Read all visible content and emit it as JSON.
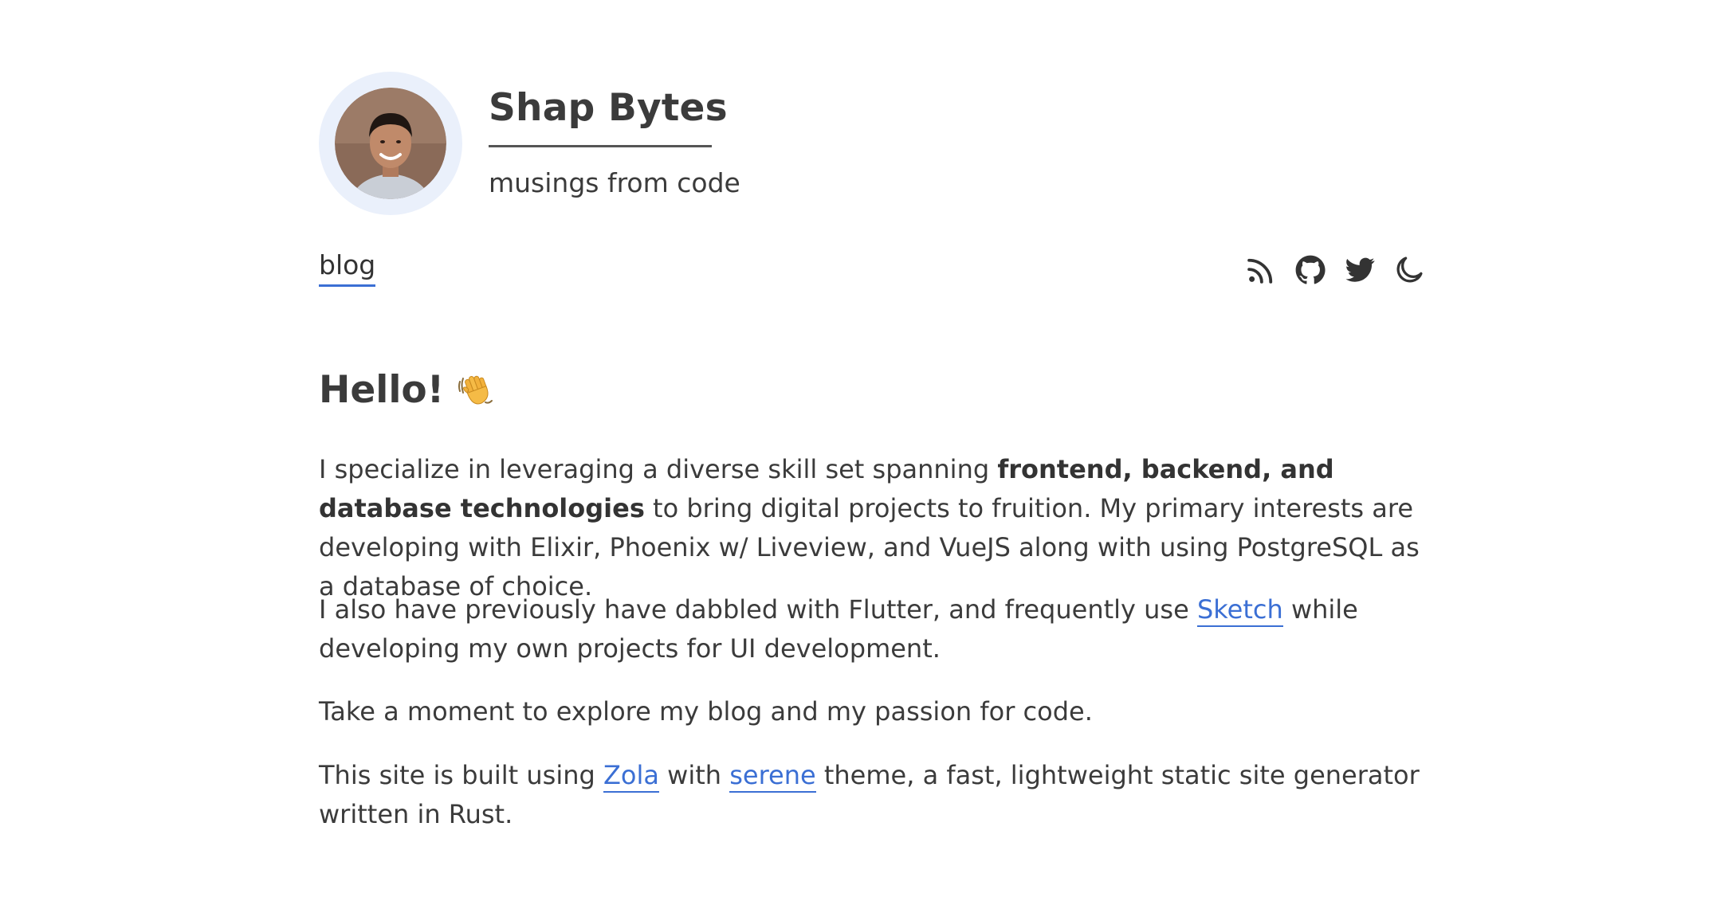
{
  "site": {
    "title": "Shap Bytes",
    "subtitle": "musings from code"
  },
  "nav": {
    "links": [
      {
        "label": "blog"
      }
    ],
    "icons": [
      "rss-icon",
      "github-icon",
      "twitter-icon",
      "moon-icon"
    ]
  },
  "main": {
    "heading": "Hello!",
    "heading_emoji": "waving-hand-icon",
    "p1": {
      "pre": "I specialize in leveraging a diverse skill set spanning ",
      "bold": "frontend, backend, and database tech­nologies",
      "post": " to bring digital projects to fruition. My primary interests are developing with Elixir, Phoenix w/ Liveview, and VueJS along with using PostgreSQL as a database of choice."
    },
    "p2": {
      "pre": "I also have previously have dabbled with Flutter, and frequently use ",
      "link": "Sketch",
      "post": " while developing my own projects for UI development."
    },
    "p3": {
      "text": "Take a moment to explore my blog and my passion for code."
    },
    "p4": {
      "pre": "This site is built using ",
      "link1": "Zola",
      "mid": " with ",
      "link2": "serene",
      "post": " theme, a fast, lightweight static site generator written in Rust."
    }
  },
  "colors": {
    "text": "#333333",
    "link": "#3b6fd4",
    "avatar_ring": "#eaf0fb"
  }
}
